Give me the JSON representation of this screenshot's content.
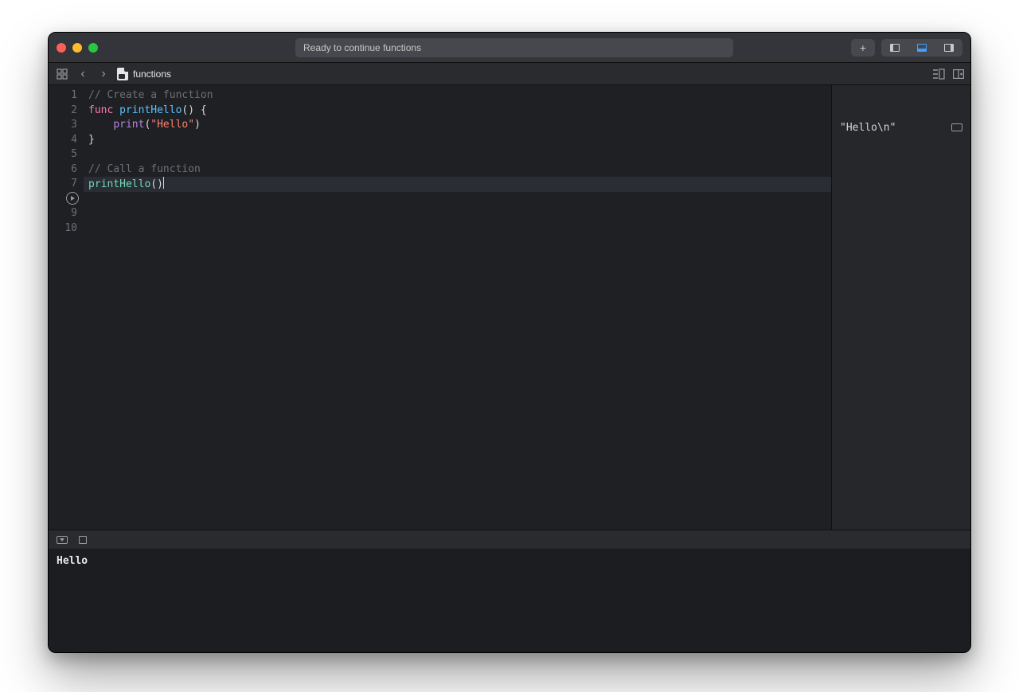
{
  "titlebar": {
    "status": "Ready to continue functions",
    "add_label": "+"
  },
  "navbar": {
    "filename": "functions"
  },
  "editor": {
    "line_numbers": [
      "1",
      "2",
      "3",
      "4",
      "5",
      "6",
      "7",
      "",
      "9",
      "10"
    ],
    "run_line_index": 7,
    "highlight_line_index": 6,
    "lines": [
      [
        {
          "cls": "tok-comment",
          "t": "// Create a function"
        }
      ],
      [
        {
          "cls": "tok-keyword",
          "t": "func "
        },
        {
          "cls": "tok-func",
          "t": "printHello"
        },
        {
          "cls": "tok-plain",
          "t": "() {"
        }
      ],
      [
        {
          "cls": "tok-plain",
          "t": "    "
        },
        {
          "cls": "tok-builtin",
          "t": "print"
        },
        {
          "cls": "tok-plain",
          "t": "("
        },
        {
          "cls": "tok-string",
          "t": "\"Hello\""
        },
        {
          "cls": "tok-plain",
          "t": ")"
        }
      ],
      [
        {
          "cls": "tok-plain",
          "t": "}"
        }
      ],
      [],
      [
        {
          "cls": "tok-comment",
          "t": "// Call a function"
        }
      ],
      [
        {
          "cls": "tok-call",
          "t": "printHello"
        },
        {
          "cls": "tok-plain",
          "t": "()"
        },
        {
          "cls": "caret",
          "t": ""
        }
      ],
      [],
      [],
      []
    ]
  },
  "results": {
    "value": "\"Hello\\n\""
  },
  "console": {
    "output": "Hello"
  }
}
